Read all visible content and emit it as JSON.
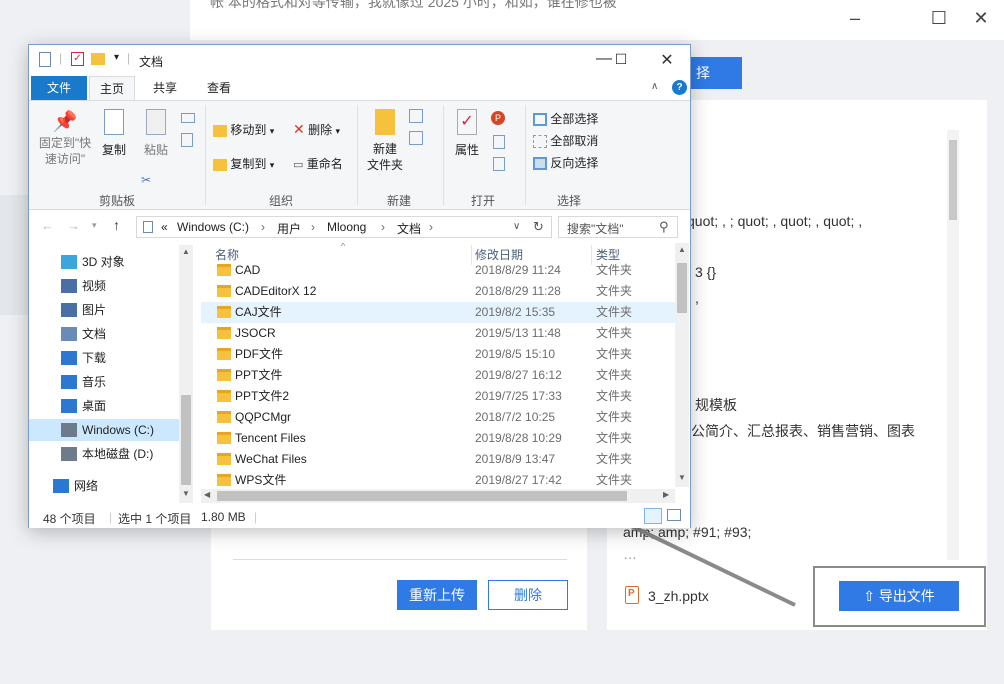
{
  "background_app": {
    "top_text": "帐   本的格式和对等传输，我就像过 2025 小时，和如，谁在修也被",
    "select_button": "择",
    "window_controls": [
      "–",
      "☐",
      "✕"
    ],
    "reupload_button": "重新上传",
    "delete_button": "删除",
    "export_button": "导出文件",
    "output_file": "3_zh.pptx",
    "preview_lines": [
      "quot; , ; quot; , quot; , quot; ,",
      "3  {}",
      ",",
      "规模板",
      "公简介、汇总报表、销售营销、图表",
      "amp; amp;  #91;  #93;",
      "…"
    ]
  },
  "explorer": {
    "title": "文档",
    "window_controls": [
      "—",
      "☐",
      "✕"
    ],
    "tabs": {
      "file": "文件",
      "home": "主页",
      "share": "共享",
      "view": "查看"
    },
    "ribbon": {
      "pin_quick": "固定到\"快\n速访问\"",
      "copy": "复制",
      "paste": "粘贴",
      "clipboard_group": "剪贴板",
      "move_to": "移动到",
      "copy_to": "复制到",
      "delete": "删除",
      "rename": "重命名",
      "organize_group": "组织",
      "new_folder": "新建\n文件夹",
      "new_group": "新建",
      "properties": "属性",
      "open_group": "打开",
      "select_all": "全部选择",
      "select_none": "全部取消",
      "invert_select": "反向选择",
      "select_group": "选择"
    },
    "address": {
      "prefix": "«",
      "crumbs": [
        "Windows (C:)",
        "用户",
        "Mloong",
        "文档"
      ],
      "search_placeholder": "搜索\"文档\""
    },
    "nav": [
      {
        "label": "3D 对象",
        "icon": "cube-icon"
      },
      {
        "label": "视频",
        "icon": "video-icon"
      },
      {
        "label": "图片",
        "icon": "picture-icon"
      },
      {
        "label": "文档",
        "icon": "document-icon"
      },
      {
        "label": "下载",
        "icon": "download-icon"
      },
      {
        "label": "音乐",
        "icon": "music-icon"
      },
      {
        "label": "桌面",
        "icon": "desktop-icon"
      },
      {
        "label": "Windows (C:)",
        "icon": "drive-icon"
      },
      {
        "label": "本地磁盘 (D:)",
        "icon": "drive-icon"
      },
      {
        "label": "网络",
        "icon": "network-icon"
      }
    ],
    "columns": {
      "name": "名称",
      "date": "修改日期",
      "type": "类型"
    },
    "files": [
      {
        "name": "CAD",
        "date": "2018/8/29 11:24",
        "type": "文件夹"
      },
      {
        "name": "CADEditorX 12",
        "date": "2018/8/29 11:28",
        "type": "文件夹"
      },
      {
        "name": "CAJ文件",
        "date": "2019/8/2 15:35",
        "type": "文件夹"
      },
      {
        "name": "JSOCR",
        "date": "2019/5/13 11:48",
        "type": "文件夹"
      },
      {
        "name": "PDF文件",
        "date": "2019/8/5 15:10",
        "type": "文件夹"
      },
      {
        "name": "PPT文件",
        "date": "2019/8/27 16:12",
        "type": "文件夹"
      },
      {
        "name": "PPT文件2",
        "date": "2019/7/25 17:33",
        "type": "文件夹"
      },
      {
        "name": "QQPCMgr",
        "date": "2018/7/2 10:25",
        "type": "文件夹"
      },
      {
        "name": "Tencent Files",
        "date": "2019/8/28 10:29",
        "type": "文件夹"
      },
      {
        "name": "WeChat Files",
        "date": "2019/8/9 13:47",
        "type": "文件夹"
      },
      {
        "name": "WPS文件",
        "date": "2019/8/27 17:42",
        "type": "文件夹"
      }
    ],
    "status": {
      "count": "48 个项目",
      "selected": "选中 1 个项目",
      "size": "1.80 MB"
    }
  }
}
